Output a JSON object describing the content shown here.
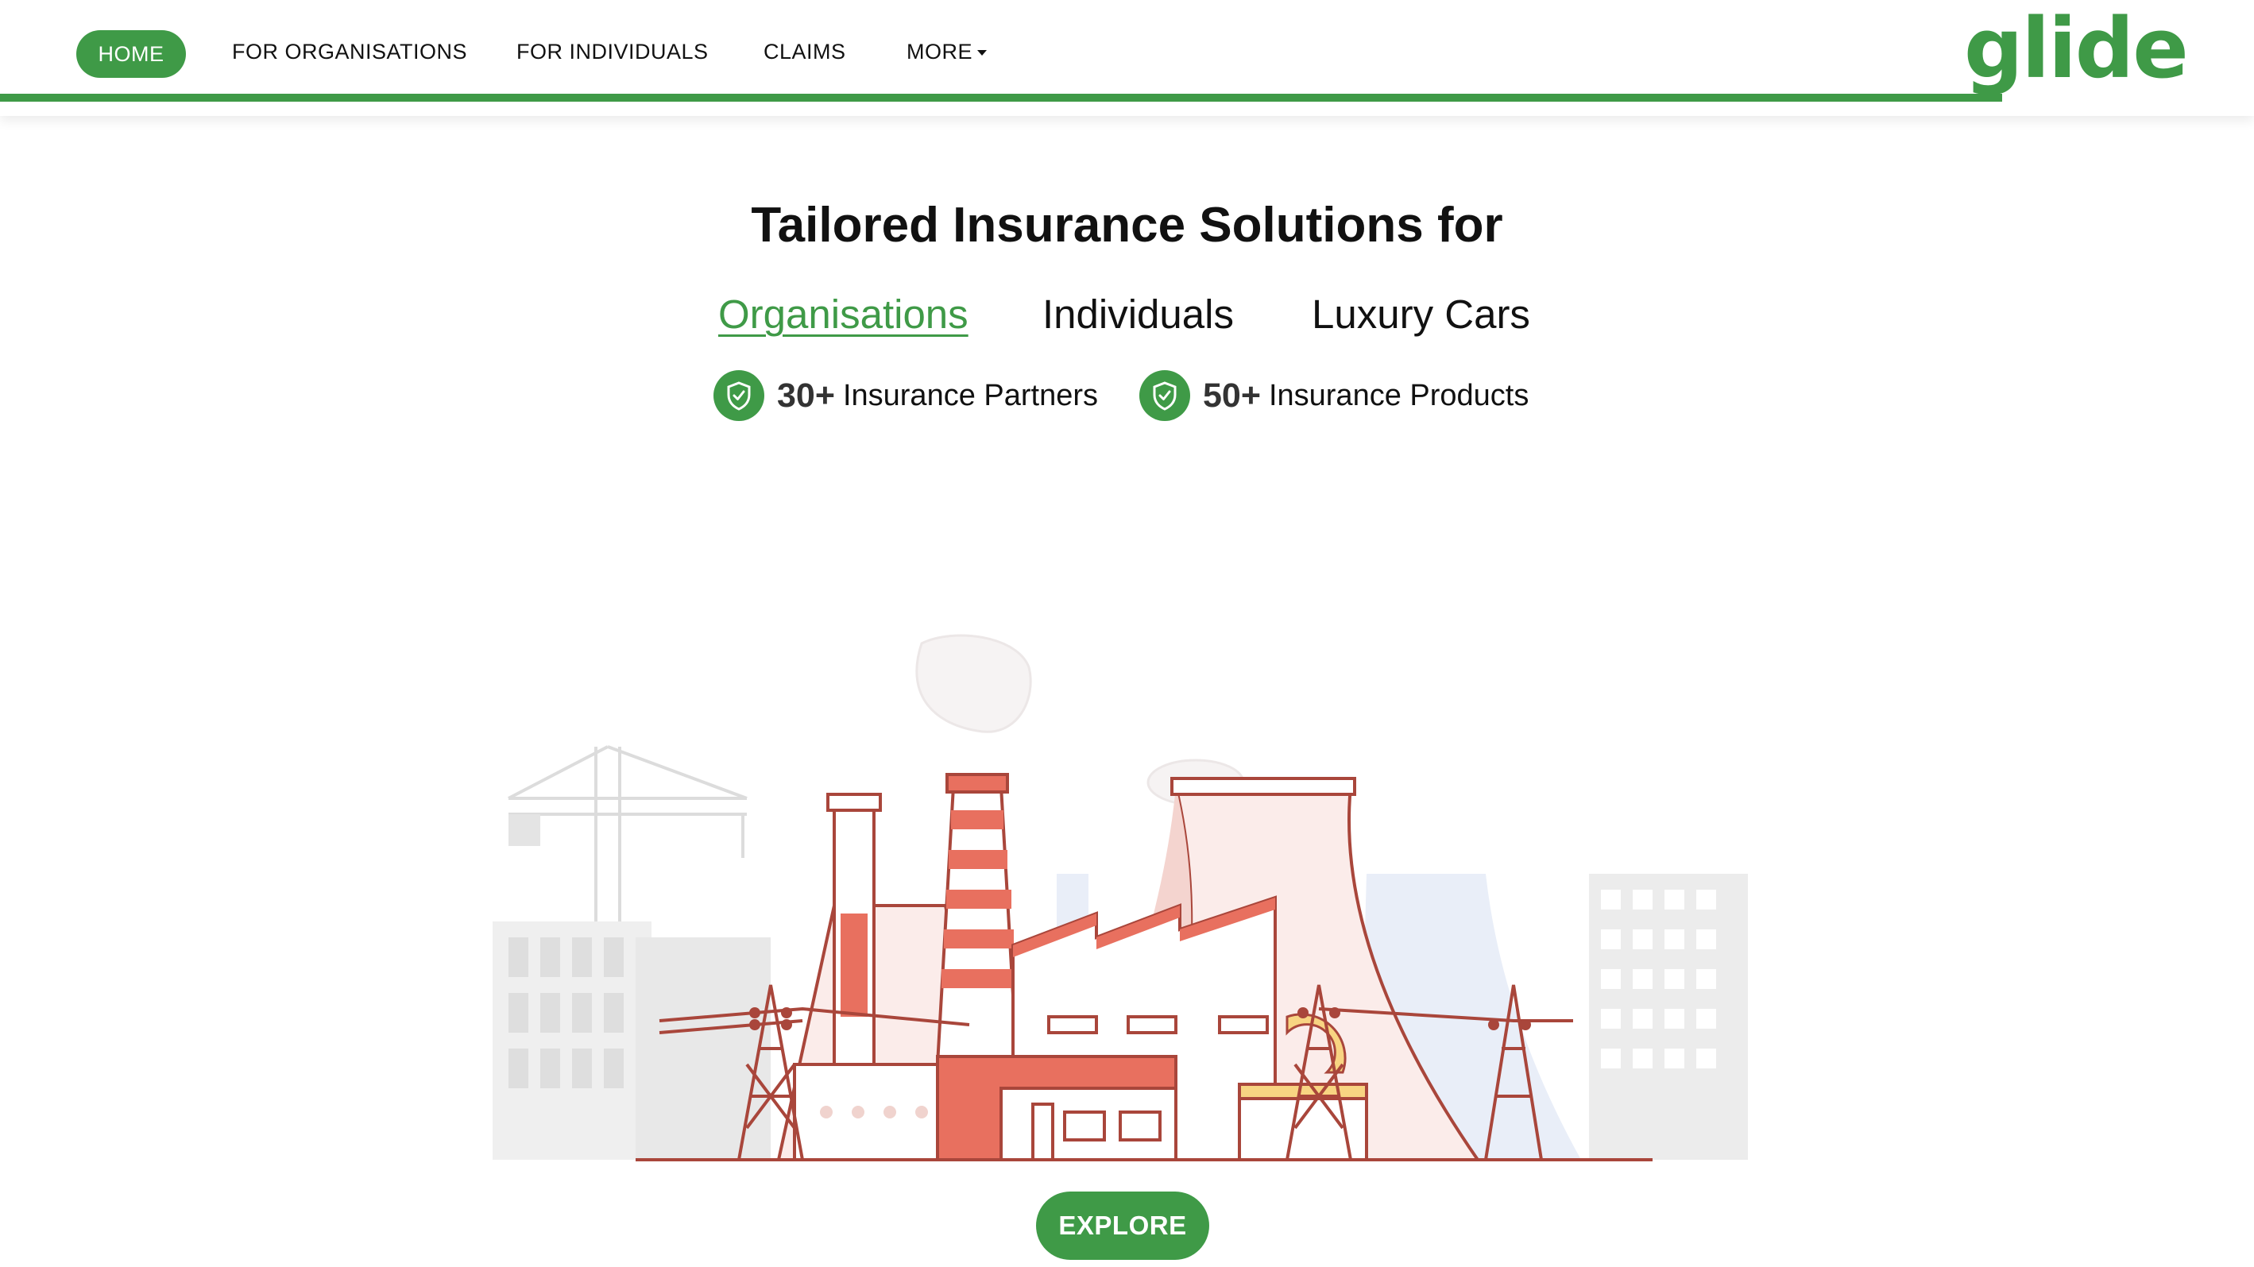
{
  "nav": {
    "home": "HOME",
    "organisations": "FOR ORGANISATIONS",
    "individuals": "FOR INDIVIDUALS",
    "claims": "CLAIMS",
    "more": "MORE"
  },
  "logo": "glide",
  "hero": {
    "title": "Tailored Insurance Solutions for",
    "tabs": [
      "Organisations",
      "Individuals",
      "Luxury Cars"
    ],
    "active_tab": "Organisations",
    "stats": [
      {
        "number": "30+",
        "label": "Insurance Partners"
      },
      {
        "number": "50+",
        "label": "Insurance Products"
      }
    ]
  },
  "illustration": {
    "icon": "factory-illustration"
  },
  "explore_label": "EXPLORE",
  "colors": {
    "brand": "#3f9a47",
    "accent_red": "#e8705f",
    "outline": "#9e3b32"
  }
}
